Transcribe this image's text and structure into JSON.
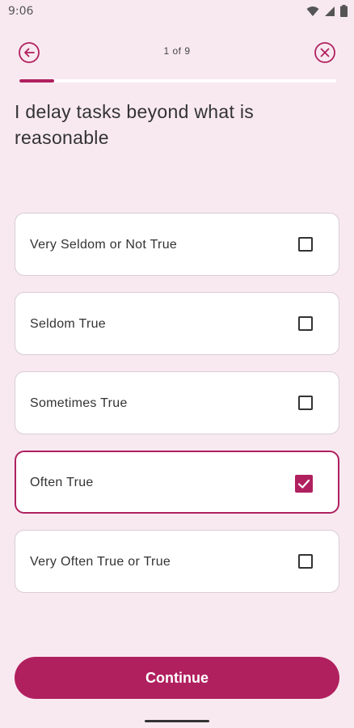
{
  "status_bar": {
    "time": "9:06"
  },
  "header": {
    "progress_text": "1 of 9",
    "progress_fraction": 0.11,
    "back_icon": "arrow-left-circle-icon",
    "close_icon": "close-circle-icon"
  },
  "question": "I delay tasks beyond what is reasonable",
  "options": [
    {
      "label": "Very Seldom or Not True",
      "checked": false
    },
    {
      "label": "Seldom True",
      "checked": false
    },
    {
      "label": "Sometimes True",
      "checked": false
    },
    {
      "label": "Often True",
      "checked": true
    },
    {
      "label": "Very Often True or True",
      "checked": false
    }
  ],
  "continue_label": "Continue",
  "colors": {
    "accent": "#b0205f",
    "background": "#f8e9f0",
    "card": "#ffffff"
  }
}
